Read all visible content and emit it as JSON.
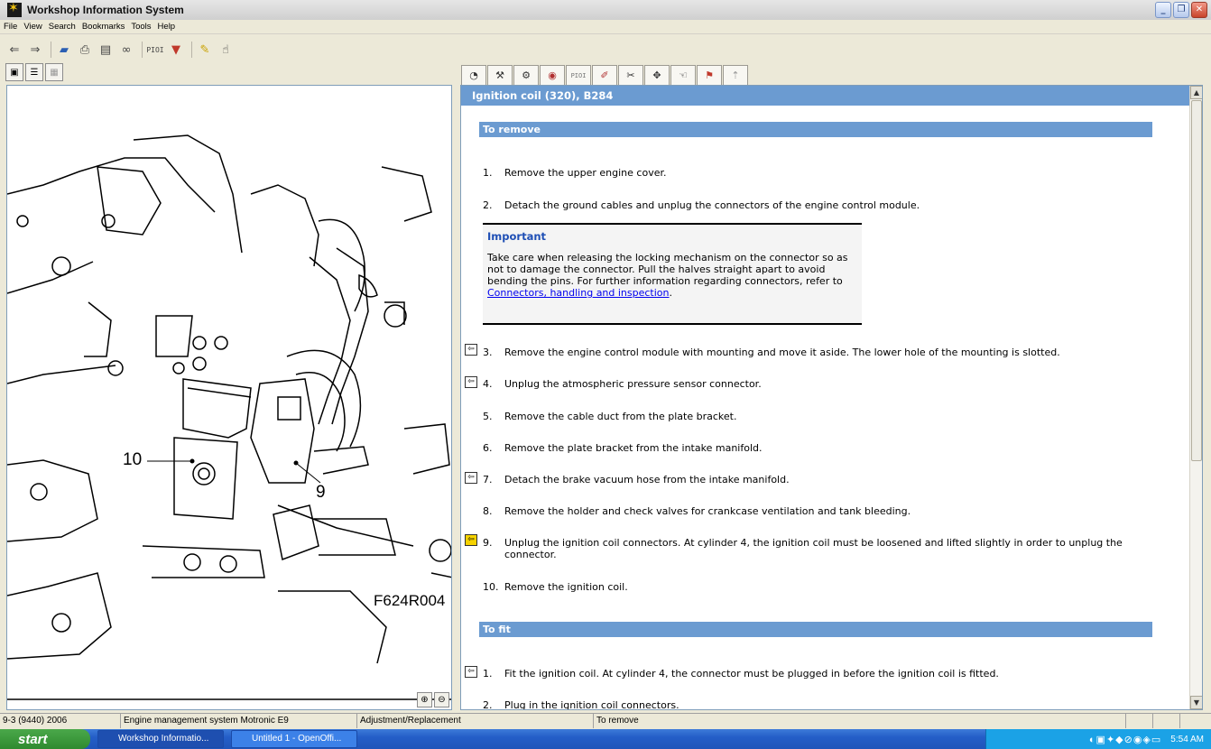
{
  "window": {
    "title": "Workshop Information System"
  },
  "menu": [
    "File",
    "View",
    "Search",
    "Bookmarks",
    "Tools",
    "Help"
  ],
  "toolbar": {
    "icons": [
      "back-arrow-icon",
      "forward-arrow-icon",
      "car-icon",
      "printer-icon",
      "export-icon",
      "binoculars-icon",
      "piol-icon",
      "filter-icon",
      "pencil-icon",
      "pointer-icon"
    ],
    "piol_label": "PIOI"
  },
  "left_tabs": [
    "tree-icon",
    "list-icon",
    "image-icon"
  ],
  "right_tabs": {
    "icons": [
      "gauge-icon",
      "wrench-icon",
      "gears-icon",
      "circle-tool-icon",
      "piol-icon",
      "pen-tool-icon",
      "wrench-screwdriver-icon",
      "move-icon",
      "hand-icon",
      "warning-icon",
      "arrow-icon"
    ],
    "piol_label": "PIOI"
  },
  "illustration": {
    "callouts": [
      "10",
      "9"
    ],
    "figure_code": "F624R004"
  },
  "zoom": {
    "in_label": "⊕",
    "out_label": "⊖"
  },
  "document": {
    "title": "Ignition coil (320), B284",
    "remove_section": "To remove",
    "important_title": "Important",
    "important_text": "Take care when releasing the locking mechanism on the connector so as not to damage the connector. Pull the halves straight apart to avoid bending the pins. For further information regarding connectors, refer to ",
    "important_link": "Connectors, handling and inspection",
    "important_end": ".",
    "remove_steps": [
      {
        "num": "1.",
        "text": "Remove the upper engine cover."
      },
      {
        "num": "2.",
        "text": "Detach the ground cables and unplug the connectors of the engine control module."
      },
      {
        "num": "3.",
        "text": "Remove the engine control module with mounting and move it aside. The lower hole of the mounting is slotted."
      },
      {
        "num": "4.",
        "text": "Unplug the atmospheric pressure sensor connector."
      },
      {
        "num": "5.",
        "text": "Remove the cable duct from the plate bracket."
      },
      {
        "num": "6.",
        "text": "Remove the plate bracket from the intake manifold."
      },
      {
        "num": "7.",
        "text": "Detach the brake vacuum hose from the intake manifold."
      },
      {
        "num": "8.",
        "text": "Remove the holder and check valves for crankcase ventilation and tank bleeding."
      },
      {
        "num": "9.",
        "text": "Unplug the ignition coil connectors. At cylinder 4, the ignition coil must be loosened and lifted slightly in order to unplug the connector."
      },
      {
        "num": "10.",
        "text": "Remove the ignition coil."
      }
    ],
    "fit_section": "To fit",
    "fit_steps": [
      {
        "num": "1.",
        "text": "Fit the ignition coil. At cylinder 4, the connector must be plugged in before the ignition coil is fitted."
      },
      {
        "num": "2.",
        "text": "Plug in the ignition coil connectors."
      }
    ]
  },
  "statusbar": [
    "9-3 (9440) 2006",
    "Engine management system Motronic E9",
    "Adjustment/Replacement",
    "To remove",
    "",
    "",
    ""
  ],
  "taskbar": {
    "start": "start",
    "items": [
      "Workshop Informatio...",
      "Untitled 1 - OpenOffi..."
    ],
    "clock": "5:54 AM"
  }
}
